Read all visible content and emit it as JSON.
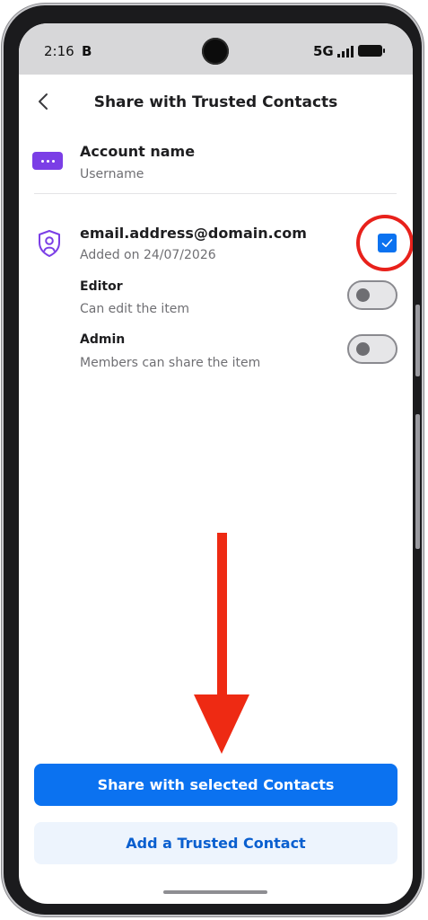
{
  "status_bar": {
    "time": "2:16",
    "indicator": "B",
    "network": "5G"
  },
  "header": {
    "title": "Share with Trusted Contacts",
    "back_icon": "chevron-left-icon"
  },
  "item": {
    "icon": "password-dots-icon",
    "icon_color": "#7b3ee6",
    "name": "Account name",
    "subtitle": "Username"
  },
  "contact": {
    "icon": "shield-user-icon",
    "email": "email.address@domain.com",
    "added": "Added on 24/07/2026",
    "selected": true
  },
  "permissions": [
    {
      "label": "Editor",
      "description": "Can edit the item",
      "enabled": false
    },
    {
      "label": "Admin",
      "description": "Members can share the item",
      "enabled": false
    }
  ],
  "annotations": {
    "highlight_color": "#e8211b",
    "arrow_direction": "down"
  },
  "actions": {
    "share_label": "Share with selected Contacts",
    "add_label": "Add a Trusted Contact"
  },
  "colors": {
    "accent": "#0b72f0",
    "secondary_bg": "#edf4fd",
    "secondary_text": "#0a5fcf"
  }
}
